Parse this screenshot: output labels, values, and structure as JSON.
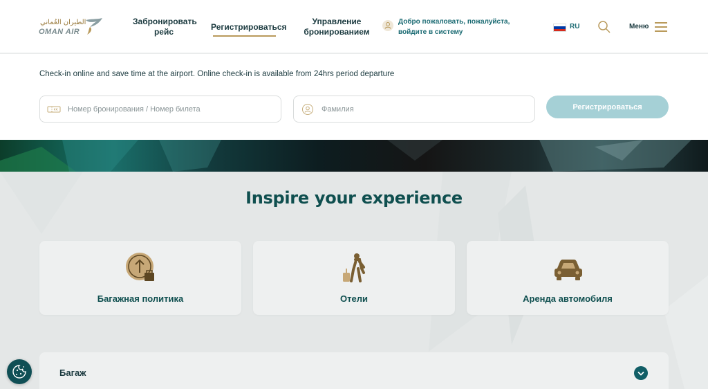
{
  "header": {
    "logo": {
      "arabic_text": "الطيران العُماني",
      "brand_text": "OMAN AIR"
    },
    "nav": {
      "book_flight": "Забронировать рейс",
      "check_in": "Регистрироваться",
      "manage_booking": "Управление бронированием"
    },
    "login_text": "Добро пожаловать, пожалуйста, войдите в систему",
    "language": {
      "code": "RU",
      "flag_colors": [
        "#ffffff",
        "#0039a6",
        "#d52b1e"
      ]
    },
    "menu_label": "Меню"
  },
  "checkin": {
    "info_text": "Check-in online and save time at the airport. Online check-in is available from 24hrs period departure",
    "booking_placeholder": "Номер бронирования / Номер билета",
    "surname_placeholder": "Фамилия",
    "submit_label": "Регистрироваться"
  },
  "inspire": {
    "title": "Inspire your experience",
    "cards": [
      {
        "label": "Багажная политика",
        "icon": "baggage-upload-icon"
      },
      {
        "label": "Отели",
        "icon": "traveler-luggage-icon"
      },
      {
        "label": "Аренда автомобиля",
        "icon": "car-icon"
      }
    ]
  },
  "accordion": {
    "label": "Багаж"
  },
  "colors": {
    "accent_gold": "#b99a5b",
    "dark_teal": "#0f4f4f",
    "button_disabled": "#a5d0d6"
  }
}
